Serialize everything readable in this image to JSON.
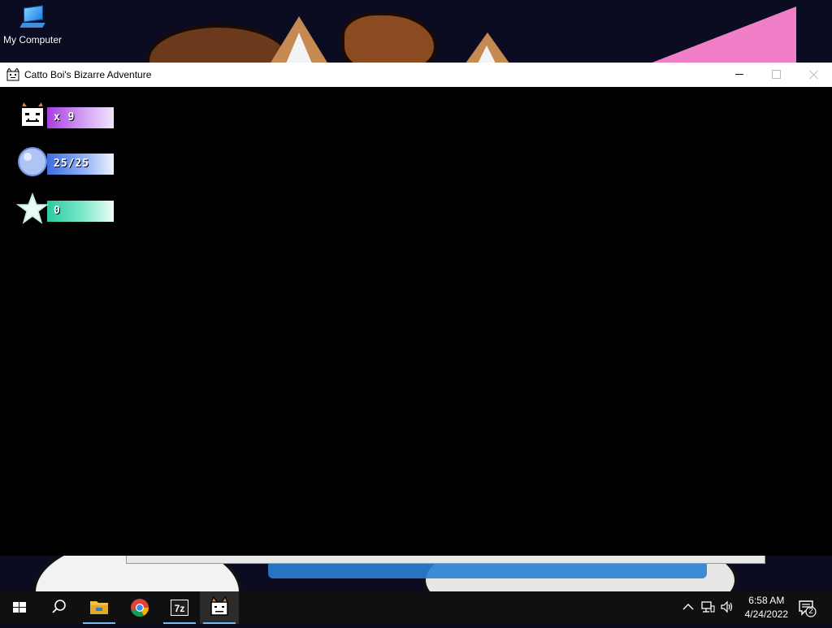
{
  "desktop": {
    "icons": [
      {
        "label": "My Computer",
        "icon": "computer-icon"
      }
    ]
  },
  "window": {
    "title": "Catto Boi's Bizarre Adventure",
    "icon": "catto-app-icon"
  },
  "hud": {
    "lives": {
      "icon": "cat-face-icon",
      "text": "x 9",
      "color": "#b44fe6"
    },
    "health": {
      "icon": "orb-icon",
      "text": "25/25",
      "color": "#4a78e6"
    },
    "stars": {
      "icon": "star-icon",
      "text": "0",
      "color": "#2fd1a8"
    }
  },
  "taskbar": {
    "items": [
      {
        "name": "start",
        "icon": "windows-logo-icon"
      },
      {
        "name": "search",
        "icon": "search-icon"
      },
      {
        "name": "file-explorer",
        "icon": "folder-icon"
      },
      {
        "name": "chrome",
        "icon": "chrome-icon"
      },
      {
        "name": "7-zip",
        "icon": "7zip-icon",
        "label": "7z"
      },
      {
        "name": "catto-boi",
        "icon": "catto-app-icon",
        "active": true
      }
    ],
    "clock": {
      "time": "6:58 AM",
      "date": "4/24/2022"
    },
    "notifications": {
      "count": "2"
    }
  }
}
